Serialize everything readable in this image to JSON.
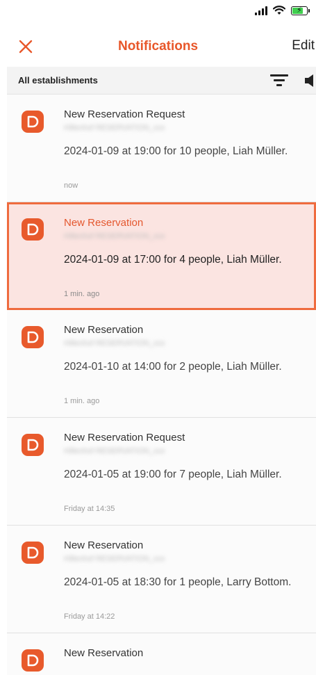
{
  "nav": {
    "title": "Notifications",
    "edit_label": "Edit",
    "close_icon": "close-icon"
  },
  "filter": {
    "label": "All establishments",
    "filter_icon": "filter-icon",
    "sound_icon": "speaker-icon"
  },
  "colors": {
    "accent": "#e85a2c",
    "highlight_bg": "#fbe4e1",
    "highlight_border": "#ef6b3e"
  },
  "notifications": [
    {
      "title": "New Reservation Request",
      "subtitle": "Hillenhof RESERVATION_xxx",
      "body": "2024-01-09 at 19:00 for 10 people, Liah Müller.",
      "time": "now"
    },
    {
      "title": "New Reservation",
      "subtitle": "Hillenhof RESERVATION_xxx",
      "body": "2024-01-09 at 17:00 for 4 people, Liah Müller.",
      "time": "1 min. ago"
    },
    {
      "title": "New Reservation",
      "subtitle": "Hillenhof RESERVATION_xxx",
      "body": "2024-01-10 at 14:00 for 2 people, Liah Müller.",
      "time": "1 min. ago"
    },
    {
      "title": "New Reservation Request",
      "subtitle": "Hillenhof RESERVATION_xxx",
      "body": "2024-01-05 at 19:00 for 7 people, Liah Müller.",
      "time": "Friday at 14:35"
    },
    {
      "title": "New Reservation",
      "subtitle": "Hillenhof RESERVATION_xxx",
      "body": "2024-01-05 at 18:30 for 1 people, Larry Bottom.",
      "time": "Friday at 14:22"
    },
    {
      "title": "New Reservation"
    }
  ]
}
